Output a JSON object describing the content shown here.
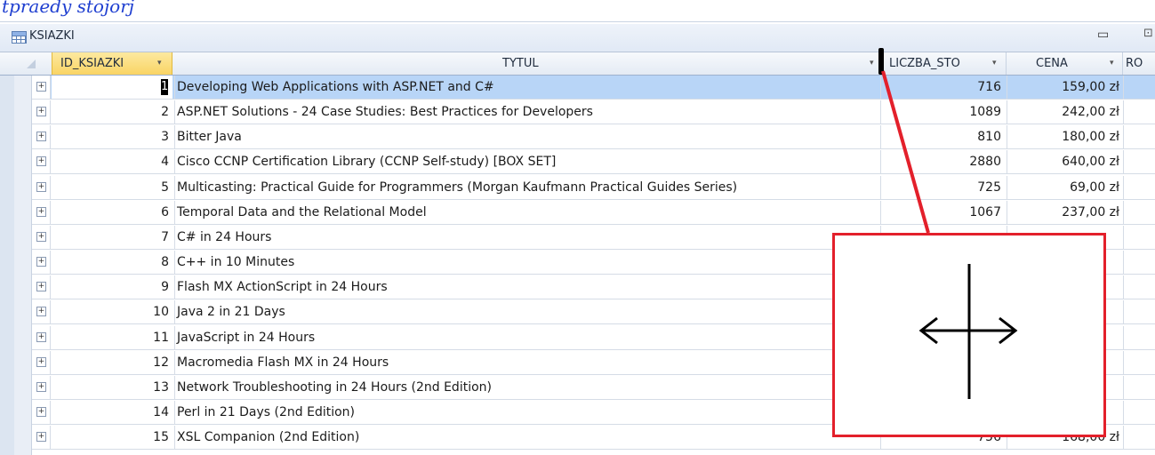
{
  "caption": "tpraedy stojorj",
  "panel": {
    "title": "KSIAZKI",
    "min_glyph": "▭",
    "max_glyph": "⊡"
  },
  "columns": [
    {
      "label": "ID_KSIAZKI",
      "sort": "▾"
    },
    {
      "label": "TYTUL",
      "sort": "▾"
    },
    {
      "label": "LICZBA_STO",
      "sort": "▾"
    },
    {
      "label": "CENA",
      "sort": "▾"
    },
    {
      "label": "RO"
    }
  ],
  "expand_glyph": "+",
  "rows": [
    {
      "id": "1",
      "tytul": "Developing Web Applications with ASP.NET and C#",
      "liczba": "716",
      "cena": "159,00 zł"
    },
    {
      "id": "2",
      "tytul": "ASP.NET Solutions - 24 Case Studies: Best Practices for Developers",
      "liczba": "1089",
      "cena": "242,00 zł"
    },
    {
      "id": "3",
      "tytul": "Bitter Java",
      "liczba": "810",
      "cena": "180,00 zł"
    },
    {
      "id": "4",
      "tytul": "Cisco CCNP Certification Library (CCNP Self-study) [BOX SET]",
      "liczba": "2880",
      "cena": "640,00 zł"
    },
    {
      "id": "5",
      "tytul": "Multicasting: Practical Guide for Programmers (Morgan Kaufmann Practical Guides Series)",
      "liczba": "725",
      "cena": "69,00 zł"
    },
    {
      "id": "6",
      "tytul": "Temporal Data and the Relational Model",
      "liczba": "1067",
      "cena": "237,00 zł"
    },
    {
      "id": "7",
      "tytul": "C# in 24 Hours",
      "liczba": "",
      "cena": ""
    },
    {
      "id": "8",
      "tytul": "C++ in 10 Minutes",
      "liczba": "",
      "cena": ""
    },
    {
      "id": "9",
      "tytul": "Flash MX ActionScript in 24 Hours",
      "liczba": "",
      "cena": ""
    },
    {
      "id": "10",
      "tytul": "Java 2 in 21 Days",
      "liczba": "",
      "cena": ""
    },
    {
      "id": "11",
      "tytul": "JavaScript in 24 Hours",
      "liczba": "",
      "cena": ""
    },
    {
      "id": "12",
      "tytul": "Macromedia Flash MX in 24 Hours",
      "liczba": "",
      "cena": ""
    },
    {
      "id": "13",
      "tytul": "Network Troubleshooting in 24 Hours (2nd Edition)",
      "liczba": "",
      "cena": ""
    },
    {
      "id": "14",
      "tytul": "Perl in 21 Days (2nd Edition)",
      "liczba": "",
      "cena": ""
    },
    {
      "id": "15",
      "tytul": "XSL Companion (2nd Edition)",
      "liczba": "756",
      "cena": "168,00 zł"
    }
  ],
  "callout": {
    "color": "#e3202b",
    "icon": "column-resize-cursor-icon"
  }
}
